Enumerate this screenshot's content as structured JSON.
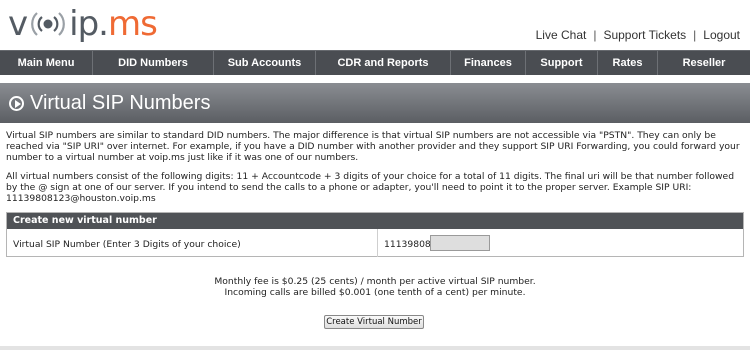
{
  "header": {
    "logo": {
      "part1": "v",
      "part2": "ip.",
      "part3": "ms"
    },
    "links": [
      {
        "label": "Live Chat"
      },
      {
        "label": "Support Tickets"
      },
      {
        "label": "Logout"
      }
    ],
    "separator": "|"
  },
  "nav": {
    "items": [
      {
        "label": "Main Menu"
      },
      {
        "label": "DID Numbers"
      },
      {
        "label": "Sub Accounts"
      },
      {
        "label": "CDR and Reports"
      },
      {
        "label": "Finances"
      },
      {
        "label": "Support"
      },
      {
        "label": "Rates"
      },
      {
        "label": "Reseller"
      }
    ]
  },
  "page": {
    "title": "Virtual SIP Numbers",
    "intro": "Virtual SIP numbers are similar to standard DID numbers. The major difference is that virtual SIP numbers are not accessible via \"PSTN\". They can only be reached via \"SIP URI\" over internet. For example, if you have a DID number with another provider and they support SIP URI Forwarding, you could forward your number to a virtual number at voip.ms just like if it was one of our numbers.",
    "details": "All virtual numbers consist of the following digits: 11 + Accountcode + 3 digits of your choice for a total of 11 digits. The final uri will be that number followed by the @ sign at one of our server. If you intend to send the calls to a phone or adapter, you'll need to point it to the proper server. Example SIP URI: 11139808123@houston.voip.ms"
  },
  "form": {
    "header": "Create new virtual number",
    "field_label": "Virtual SIP Number (Enter 3 Digits of your choice)",
    "prefix": "11139808",
    "input_value": "",
    "fee_line1": "Monthly fee is $0.25 (25 cents) / month per active virtual SIP number.",
    "fee_line2": "Incoming calls are billed $0.001 (one tenth of a cent) per minute.",
    "submit_label": "Create Virtual Number"
  },
  "colors": {
    "accent": "#ef6a34",
    "nav_bg": "#4a4d52",
    "banner_bg": "#6d7075"
  }
}
